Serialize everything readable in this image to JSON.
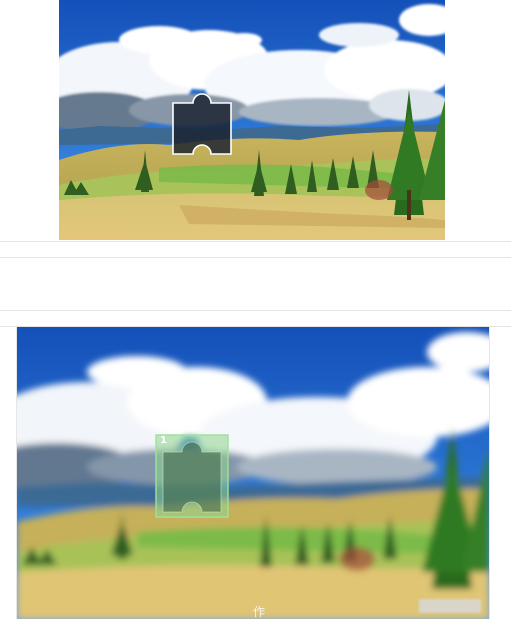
{
  "top_image": {
    "description_alt": "",
    "puzzle_piece": {
      "kind": "dark-cutout"
    }
  },
  "bottom_image": {
    "puzzle_piece": {
      "kind": "green-highlight",
      "label": "1"
    },
    "watermark": {
      "text": "作"
    }
  },
  "colors": {
    "sky": "#1d63c8",
    "cloud": "#ffffff",
    "field": "#e0c770",
    "grass": "#7cbd49",
    "tree": "#2f6b1f",
    "divider": "#e3e3e3",
    "highlight": "#8fd68e"
  }
}
